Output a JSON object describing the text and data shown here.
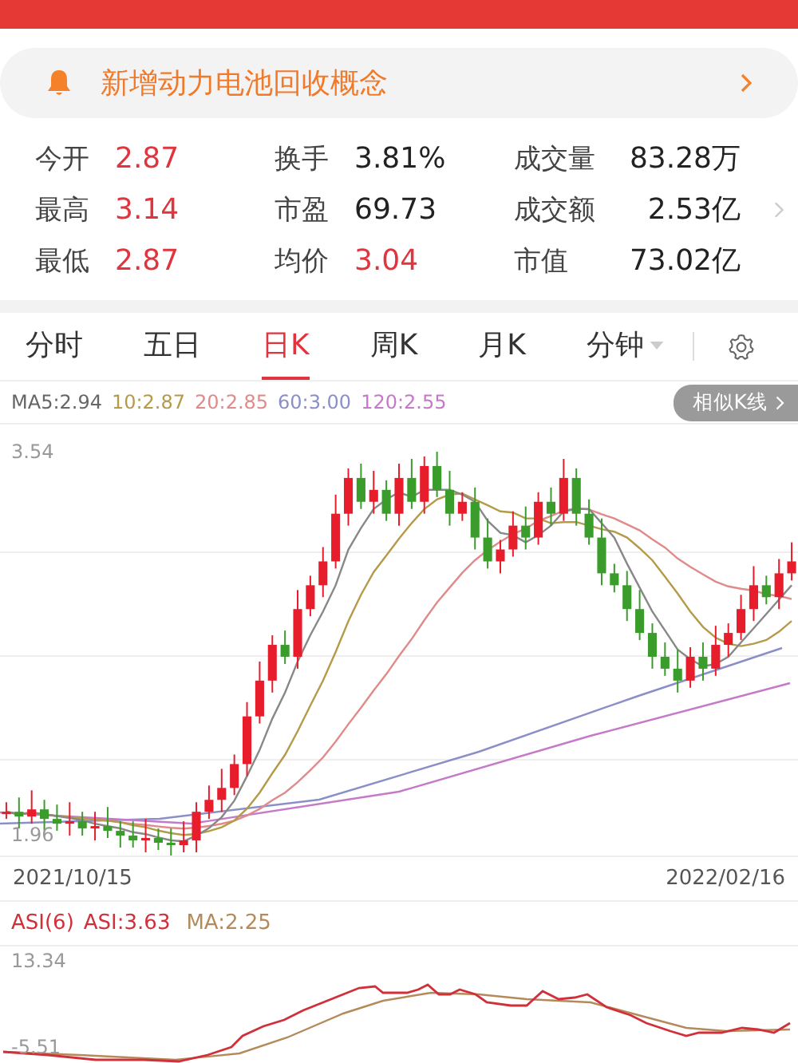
{
  "banner": {
    "text": "新增动力电池回收概念"
  },
  "stats": [
    {
      "label": "今开",
      "value": "2.87",
      "color": "#e0353f"
    },
    {
      "label": "换手",
      "value": "3.81%",
      "color": "#222222"
    },
    {
      "label": "成交量",
      "value": "83.28万",
      "color": "#222222"
    },
    {
      "label": "最高",
      "value": "3.14",
      "color": "#e0353f"
    },
    {
      "label": "市盈",
      "value": "69.73",
      "color": "#222222"
    },
    {
      "label": "成交额",
      "value": "2.53亿",
      "color": "#222222"
    },
    {
      "label": "最低",
      "value": "2.87",
      "color": "#e0353f"
    },
    {
      "label": "均价",
      "value": "3.04",
      "color": "#e0353f"
    },
    {
      "label": "市值",
      "value": "73.02亿",
      "color": "#222222"
    }
  ],
  "tabs": [
    {
      "label": "分时",
      "selected": false
    },
    {
      "label": "五日",
      "selected": false
    },
    {
      "label": "日K",
      "selected": true
    },
    {
      "label": "周K",
      "selected": false
    },
    {
      "label": "月K",
      "selected": false
    },
    {
      "label": "分钟",
      "selected": false,
      "dropdown": true
    }
  ],
  "ma_legend": [
    {
      "text": "MA5:2.94",
      "color": "#666666"
    },
    {
      "text": "10:2.87",
      "color": "#b59a4a"
    },
    {
      "text": "20:2.85",
      "color": "#e08a8a"
    },
    {
      "text": "60:3.00",
      "color": "#8a8fc8"
    },
    {
      "text": "120:2.55",
      "color": "#c47ac9"
    }
  ],
  "similar_button": {
    "label": "相似K线"
  },
  "price_chart": {
    "high_label": "3.54",
    "low_label": "1.96",
    "start_date": "2021/10/15",
    "end_date": "2022/02/16"
  },
  "indicator": {
    "name": "ASI(6)",
    "asi": "ASI:3.63",
    "ma": "MA:2.25",
    "high_label": "13.34",
    "low_label": "-5.51"
  }
}
